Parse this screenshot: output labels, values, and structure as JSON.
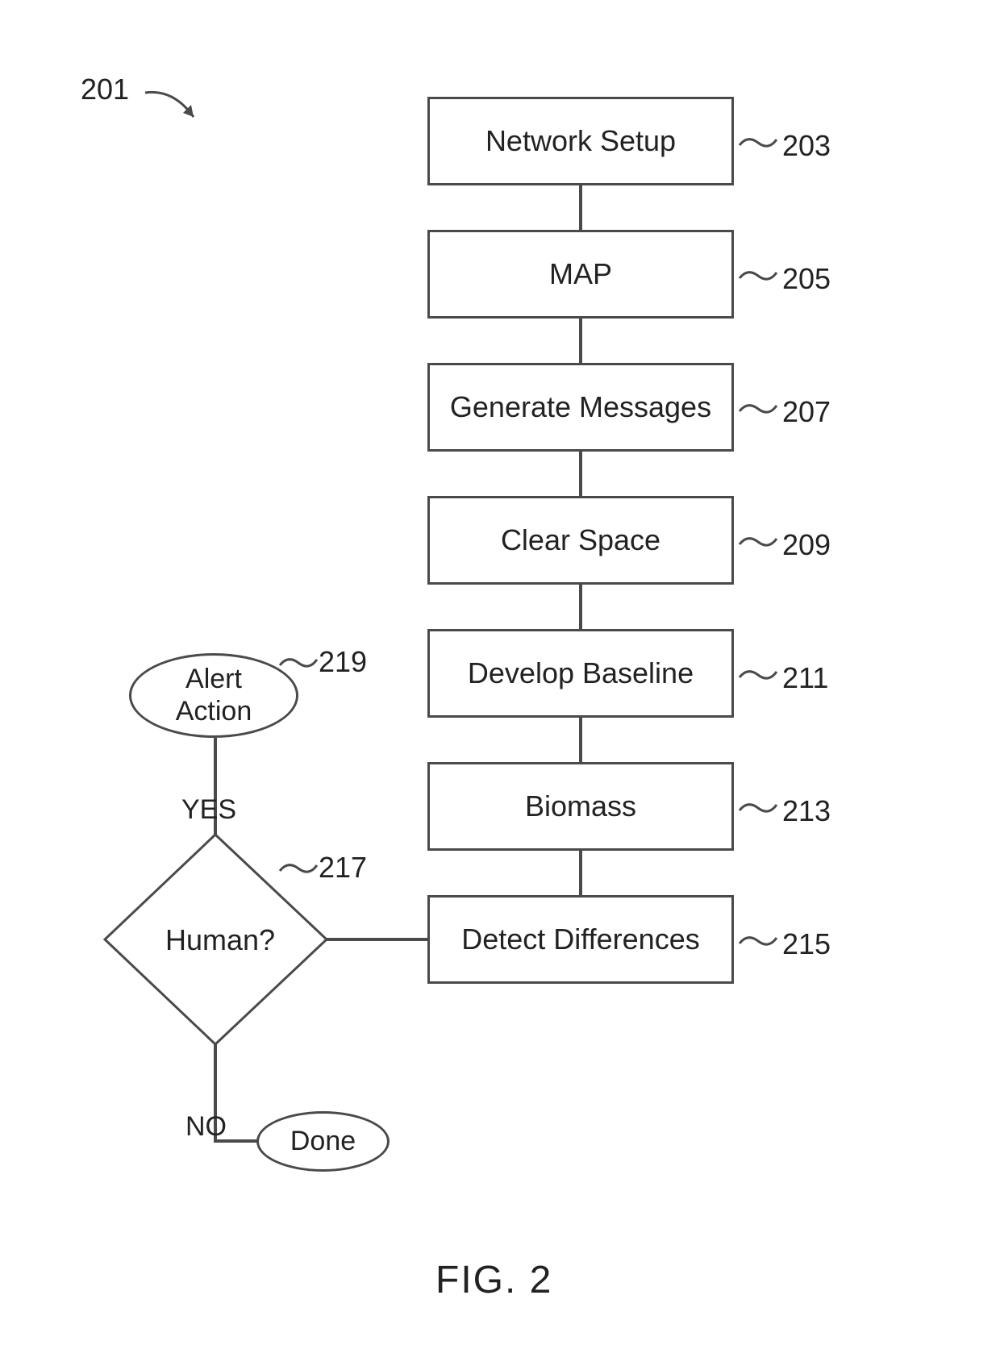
{
  "refs": {
    "figure": "201",
    "network_setup": "203",
    "map": "205",
    "generate_messages": "207",
    "clear_space": "209",
    "develop_baseline": "211",
    "biomass": "213",
    "detect_differences": "215",
    "human": "217",
    "alert_action": "219"
  },
  "boxes": {
    "network_setup": "Network Setup",
    "map": "MAP",
    "generate_messages": "Generate Messages",
    "clear_space": "Clear Space",
    "develop_baseline": "Develop Baseline",
    "biomass": "Biomass",
    "detect_differences": "Detect Differences"
  },
  "decision": {
    "human": "Human?"
  },
  "terminators": {
    "alert_action": "Alert\nAction",
    "done": "Done"
  },
  "edges": {
    "yes": "YES",
    "no": "NO"
  },
  "figure_label": "FIG. 2"
}
